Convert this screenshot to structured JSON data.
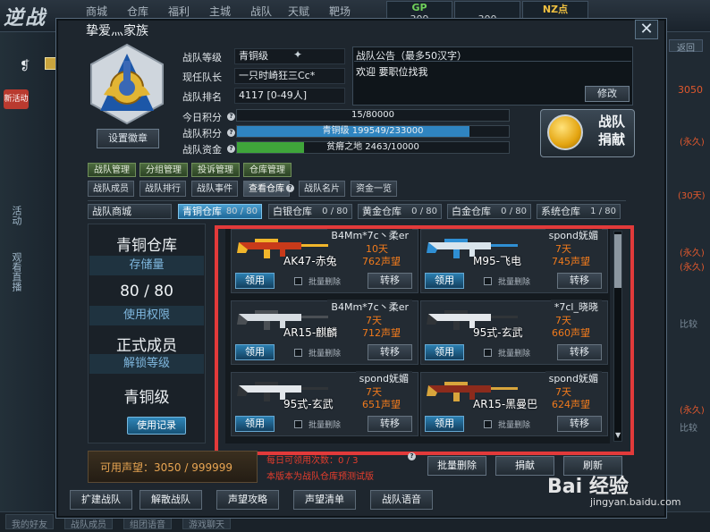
{
  "game": {
    "logo": "逆战",
    "nav": [
      "商城",
      "仓库",
      "福利",
      "主城",
      "战队",
      "天赋",
      "靶场"
    ],
    "hud": [
      {
        "label": "GP",
        "value": "309",
        "color": "#6fd05a"
      },
      {
        "label": "",
        "value": "300",
        "color": "#e7cf55"
      },
      {
        "label": "NZ点",
        "value": "500",
        "color": "#f0c040"
      }
    ],
    "side_left": [
      "新活动",
      "活动",
      "观看直播"
    ],
    "side_right": [
      "返回",
      "3050",
      "(永久)",
      "(30天)",
      "(永久)",
      "(永久)",
      "比较",
      "(永久)",
      "比较"
    ],
    "bottom_bar": [
      "我的好友",
      "战队成员",
      "组团语音",
      "游戏聊天"
    ]
  },
  "dialog": {
    "title": "挚爱灬家族",
    "badge_button": "设置徽章",
    "info": [
      {
        "label": "战队等级",
        "value": "青铜级"
      },
      {
        "label": "现任队长",
        "value": "一只时崎狂三Cc*"
      },
      {
        "label": "战队排名",
        "value": "4117 [0-49人]"
      }
    ],
    "notice": {
      "title": "战队公告（最多50汉字）",
      "body": "欢迎 要职位找我",
      "edit_button": "修改"
    },
    "stats": [
      {
        "label": "今日积分",
        "text": "15/80000",
        "fill": 0.0002,
        "color": "#3c4a55"
      },
      {
        "label": "战队积分",
        "text": "青铜级   199549/233000",
        "fill": 0.856,
        "color": "#2f84c0"
      },
      {
        "label": "战队资金",
        "text": "贫瘠之地   2463/10000",
        "fill": 0.246,
        "color": "#3fa53a"
      }
    ],
    "donate_button": "战队捐献",
    "tabs_top": [
      "战队管理",
      "分组管理",
      "投诉管理",
      "仓库管理"
    ],
    "tabs_main": [
      "战队成员",
      "战队排行",
      "战队事件",
      "查看仓库",
      "战队名片",
      "资金一览"
    ],
    "active_main_tab": 3,
    "storage_tabs": [
      {
        "label": "战队商城",
        "count": ""
      },
      {
        "label": "青铜仓库",
        "count": "80 / 80"
      },
      {
        "label": "白银仓库",
        "count": "0 / 80"
      },
      {
        "label": "黄金仓库",
        "count": "0 / 80"
      },
      {
        "label": "白金仓库",
        "count": "0 / 80"
      },
      {
        "label": "系统仓库",
        "count": "1 / 80"
      }
    ],
    "left_panel": {
      "title": "青铜仓库",
      "capacity_label": "存储量",
      "capacity": "80 / 80",
      "permission_label": "使用权限",
      "permission": "正式成员",
      "unlock_label": "解锁等级",
      "unlock": "青铜级",
      "log_button": "使用记录"
    },
    "items": [
      {
        "owner": "B4Mm*7c丶柔er",
        "name": "AK47-赤兔",
        "days": "10天",
        "fame": "762声望",
        "colors": [
          "#c83a1a",
          "#f1b62b"
        ]
      },
      {
        "owner": "spond妩媚",
        "name": "M95-飞电",
        "days": "7天",
        "fame": "745声望",
        "colors": [
          "#d9e4ec",
          "#2f8fd4"
        ]
      },
      {
        "owner": "B4Mm*7c丶柔er",
        "name": "AR15-麒麟",
        "days": "7天",
        "fame": "712声望",
        "colors": [
          "#d7dde2",
          "#4a4f54"
        ]
      },
      {
        "owner": "*7cl_晓晓",
        "name": "95式-玄武",
        "days": "7天",
        "fame": "660声望",
        "colors": [
          "#e4e8ec",
          "#303438"
        ]
      },
      {
        "owner": "spond妩媚",
        "name": "95式-玄武",
        "days": "7天",
        "fame": "651声望",
        "colors": [
          "#e4e8ec",
          "#303438"
        ]
      },
      {
        "owner": "spond妩媚",
        "name": "AR15-黑曼巴",
        "days": "7天",
        "fame": "624声望",
        "colors": [
          "#8c2b1c",
          "#d8a53c"
        ]
      }
    ],
    "item_claim": "领用",
    "item_batch_delete": "批量删除",
    "item_move": "转移",
    "fame_available": "可用声望：3050 / 999999",
    "hint_1": "每日可领用次数：0 / 3",
    "hint_2": "本版本为战队仓库预测试版",
    "actions": [
      "批量删除",
      "捐献",
      "刷新"
    ],
    "footer_buttons": [
      "扩建战队",
      "解散战队",
      "声望攻略",
      "声望清单",
      "战队语音"
    ]
  },
  "watermark": {
    "brand": "Bai 经验",
    "url": "jingyan.baidu.com"
  }
}
